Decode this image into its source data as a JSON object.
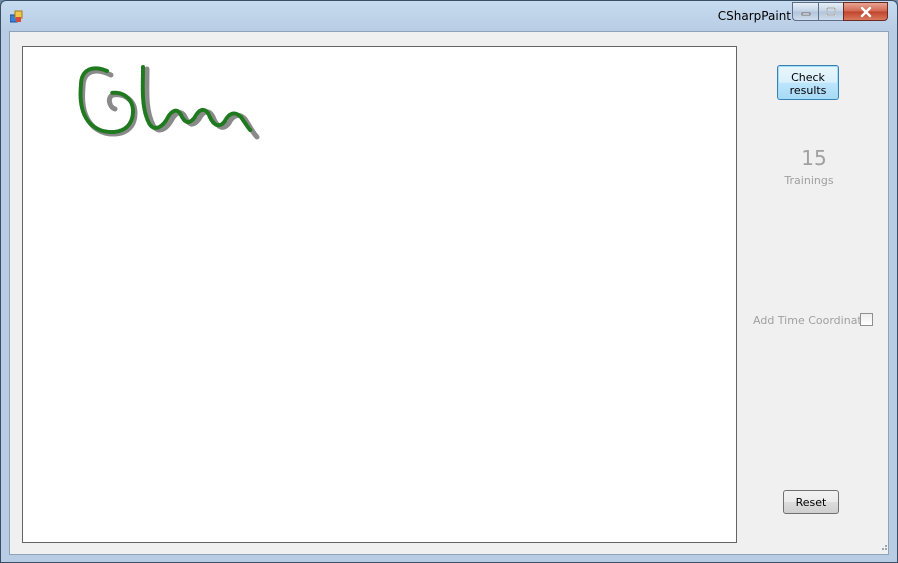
{
  "window": {
    "title": "CSharpPaint",
    "icon": "app-icon",
    "caption_buttons": [
      "minimize-icon",
      "maximize-icon",
      "close-icon"
    ]
  },
  "canvas": {
    "stroke_colors": {
      "drawn": "#808080",
      "recognized": "#1f7a1f"
    }
  },
  "sidebar": {
    "check_button_label": "Check results",
    "trainings_count": "15",
    "trainings_label": "Trainings",
    "time_coordinate_label": "Add Time Coordinate",
    "time_coordinate_checked": false,
    "reset_button_label": "Reset"
  }
}
